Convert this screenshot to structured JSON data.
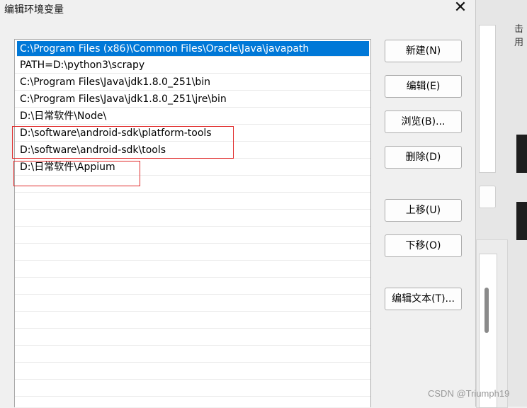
{
  "dialog": {
    "title": "编辑环境变量",
    "close_glyph": "✕"
  },
  "paths": [
    "C:\\Program Files (x86)\\Common Files\\Oracle\\Java\\javapath",
    "PATH=D:\\python3\\scrapy",
    "C:\\Program Files\\Java\\jdk1.8.0_251\\bin",
    "C:\\Program Files\\Java\\jdk1.8.0_251\\jre\\bin",
    "D:\\日常软件\\Node\\",
    "D:\\software\\android-sdk\\platform-tools",
    "D:\\software\\android-sdk\\tools",
    "D:\\日常软件\\Appium"
  ],
  "selected_index": 0,
  "buttons": {
    "new": "新建(N)",
    "edit": "编辑(E)",
    "browse": "浏览(B)...",
    "delete": "删除(D)",
    "move_up": "上移(U)",
    "move_down": "下移(O)",
    "edit_text": "编辑文本(T)..."
  },
  "background": {
    "partial_text": "击用"
  },
  "watermark": "CSDN @Triumph19",
  "annotation_color": "#e02a2a"
}
